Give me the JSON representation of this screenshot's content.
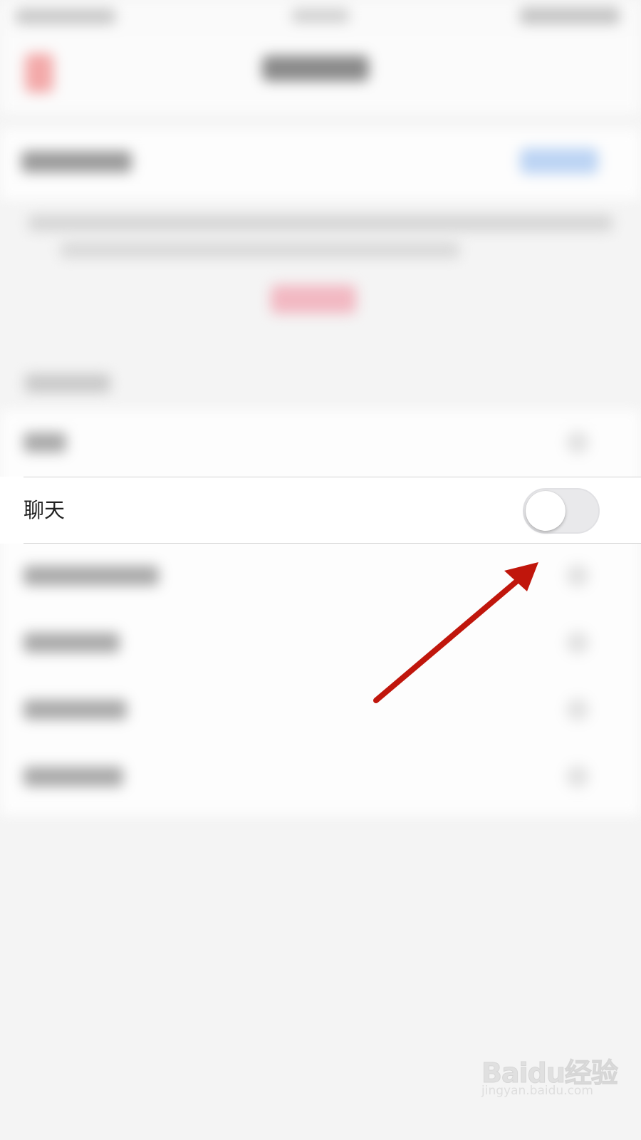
{
  "settings_row": {
    "label": "聊天",
    "toggle_on": false
  },
  "colors": {
    "toggle_track_off": "#e9e9eb",
    "toggle_knob": "#ffffff",
    "arrow": "#c0160c",
    "divider": "#d4d4d4"
  },
  "annotation": {
    "icon": "red-arrow-icon"
  },
  "watermark": {
    "logo_text": "Baidu经验",
    "sub_text": "jingyan.baidu.com"
  }
}
